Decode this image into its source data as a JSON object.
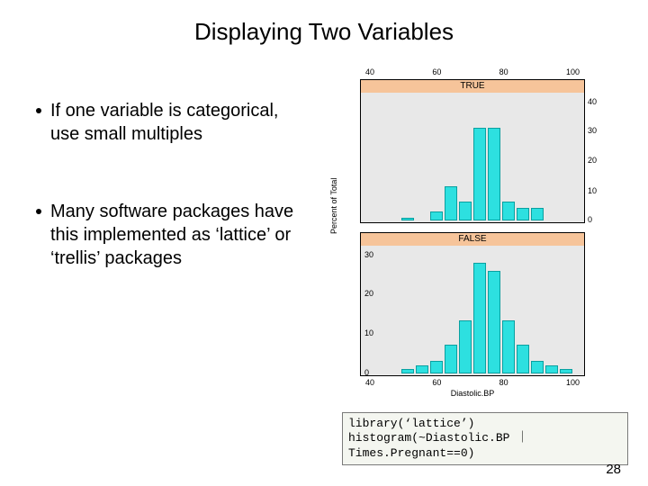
{
  "title": "Displaying Two Variables",
  "bullets": [
    "If one variable is categorical, use small multiples",
    "Many software packages have this implemented as ‘lattice’ or ‘trellis’ packages"
  ],
  "code": {
    "line1": "library(‘lattice’)",
    "line2": "histogram(~Diastolic.BP ｜Times.Pregnant==0)"
  },
  "page_number": "28",
  "chart_data": [
    {
      "type": "bar",
      "panel": "TRUE",
      "xlabel": "Diastolic.BP",
      "ylabel": "Percent of Total",
      "ylim": [
        0,
        40
      ],
      "yticks": [
        0,
        10,
        20,
        30,
        40
      ],
      "xticks": [
        40,
        60,
        80,
        100
      ],
      "x_bins": [
        35,
        40,
        45,
        50,
        55,
        60,
        65,
        70,
        75,
        80,
        85,
        90,
        95,
        100
      ],
      "values": [
        0,
        0,
        1,
        0,
        3,
        11,
        6,
        30,
        30,
        6,
        4,
        4,
        0,
        0
      ]
    },
    {
      "type": "bar",
      "panel": "FALSE",
      "xlabel": "Diastolic.BP",
      "ylabel": "Percent of Total",
      "ylim": [
        0,
        30
      ],
      "yticks": [
        0,
        10,
        20,
        30
      ],
      "xticks": [
        40,
        60,
        80,
        100
      ],
      "x_bins": [
        35,
        40,
        45,
        50,
        55,
        60,
        65,
        70,
        75,
        80,
        85,
        90,
        95,
        100
      ],
      "values": [
        0,
        0,
        1,
        2,
        3,
        7,
        13,
        27,
        25,
        13,
        7,
        3,
        2,
        1
      ]
    }
  ]
}
